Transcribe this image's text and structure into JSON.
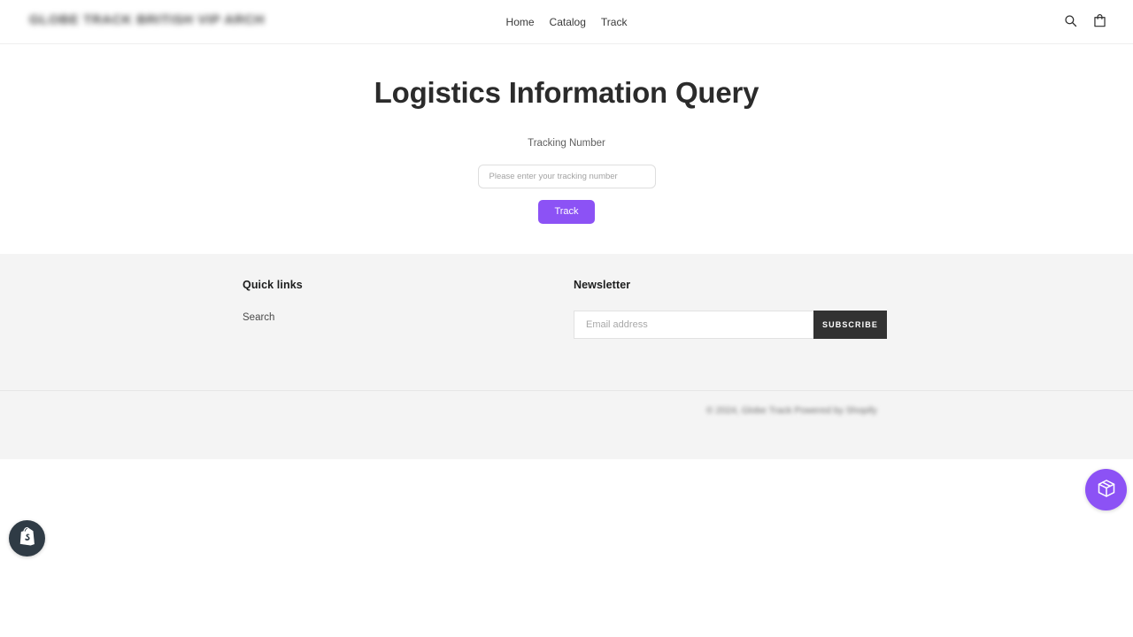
{
  "header": {
    "logo_text": "GLOBE TRACK BRITISH VIP ARCH",
    "nav": [
      {
        "label": "Home"
      },
      {
        "label": "Catalog"
      },
      {
        "label": "Track"
      }
    ],
    "icons": {
      "search": "search-icon",
      "cart": "shopping-bag-icon"
    }
  },
  "main": {
    "title": "Logistics Information Query",
    "tracking_label": "Tracking Number",
    "tracking_placeholder": "Please enter your tracking number",
    "tracking_value": "",
    "track_button": "Track",
    "accent_color": "#8c52f5"
  },
  "footer": {
    "quick_links": {
      "heading": "Quick links",
      "items": [
        {
          "label": "Search"
        }
      ]
    },
    "newsletter": {
      "heading": "Newsletter",
      "email_placeholder": "Email address",
      "email_value": "",
      "subscribe_label": "SUBSCRIBE",
      "button_color": "#323232"
    },
    "copyright": "© 2024, Globe Track Powered by Shopify",
    "background_color": "#f4f4f4"
  },
  "widgets": {
    "tracking_fab": {
      "icon": "package-box-icon",
      "color": "#8c52f5"
    },
    "shopify_badge": {
      "icon": "shopify-bag-icon",
      "color": "#2f3b45"
    }
  }
}
